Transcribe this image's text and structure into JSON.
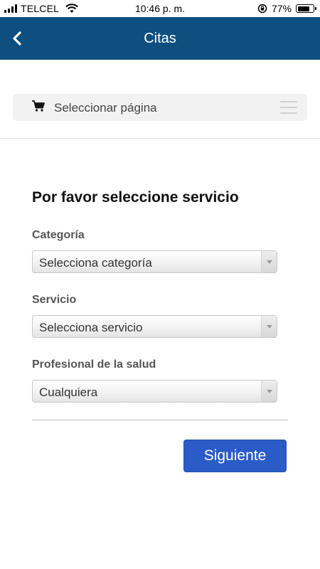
{
  "status_bar": {
    "carrier": "TELCEL",
    "time": "10:46 p. m.",
    "battery_percent": "77%",
    "battery_level": 0.77,
    "icons": [
      "signal-icon",
      "wifi-icon",
      "rotation-lock-icon",
      "battery-icon"
    ]
  },
  "navbar": {
    "title": "Citas",
    "background_color": "#0e4f80",
    "back_icon": "chevron-left-icon"
  },
  "page_selector": {
    "label": "Seleccionar página",
    "icon": "cart-icon",
    "menu_icon": "hamburger-menu-icon"
  },
  "form": {
    "title": "Por favor seleccione servicio",
    "category": {
      "label": "Categoría",
      "value": "Selecciona categoría"
    },
    "service": {
      "label": "Servicio",
      "value": "Selecciona servicio"
    },
    "professional": {
      "label": "Profesional de la salud",
      "value": "Cualquiera"
    },
    "next_button": {
      "label": "Siguiente",
      "color": "#2a5bc6"
    }
  }
}
